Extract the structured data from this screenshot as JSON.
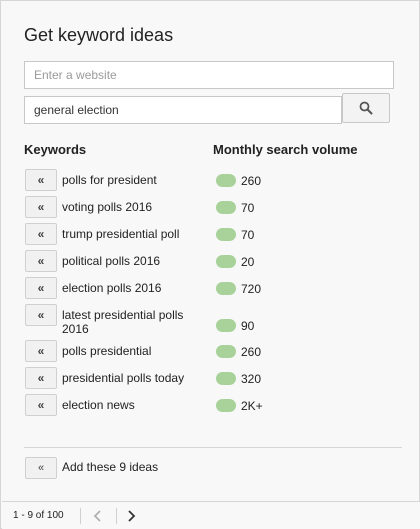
{
  "title": "Get keyword ideas",
  "website_input": {
    "placeholder": "Enter a website",
    "value": ""
  },
  "query_input": {
    "value": "general election"
  },
  "search_icon": "search-icon",
  "columns": {
    "keywords": "Keywords",
    "volume": "Monthly search volume"
  },
  "add_icon_glyph": "«",
  "rows": [
    {
      "keyword": "polls for president",
      "volume": "260"
    },
    {
      "keyword": "voting polls 2016",
      "volume": "70"
    },
    {
      "keyword": "trump presidential poll",
      "volume": "70"
    },
    {
      "keyword": "political polls 2016",
      "volume": "20"
    },
    {
      "keyword": "election polls 2016",
      "volume": "720"
    },
    {
      "keyword": "latest presidential polls 2016",
      "volume": "90"
    },
    {
      "keyword": "polls presidential",
      "volume": "260"
    },
    {
      "keyword": "presidential polls today",
      "volume": "320"
    },
    {
      "keyword": "election news",
      "volume": "2K+"
    }
  ],
  "add_all": {
    "glyph": "«",
    "label": "Add these 9 ideas"
  },
  "pagination": {
    "range": "1 - 9 of 100"
  },
  "colors": {
    "volume_bar": "#a8d29a"
  }
}
